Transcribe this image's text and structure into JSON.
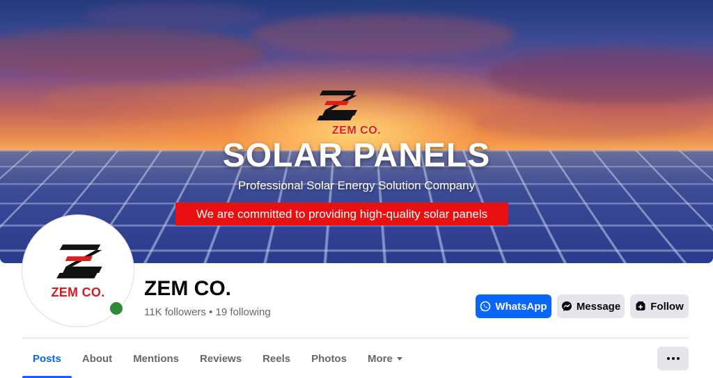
{
  "cover": {
    "brand_name": "ZEM CO.",
    "headline": "SOLAR PANELS",
    "subline": "Professional Solar Energy Solution Company",
    "banner": "We are committed to providing high-quality solar panels"
  },
  "profile": {
    "avatar_brand": "ZEM CO.",
    "name": "ZEM CO.",
    "stats": "11K followers • 19 following",
    "online": true
  },
  "actions": {
    "whatsapp": {
      "label": "WhatsApp",
      "icon": "whatsapp-icon"
    },
    "message": {
      "label": "Message",
      "icon": "messenger-icon"
    },
    "follow": {
      "label": "Follow",
      "icon": "follow-icon"
    }
  },
  "tabs": [
    {
      "label": "Posts",
      "active": true
    },
    {
      "label": "About"
    },
    {
      "label": "Mentions"
    },
    {
      "label": "Reviews"
    },
    {
      "label": "Reels"
    },
    {
      "label": "Photos"
    },
    {
      "label": "More",
      "icon": "caret-down-icon"
    }
  ],
  "more_button_icon": "ellipsis-icon",
  "colors": {
    "accent": "#0866ff",
    "brand_red": "#e01e1e",
    "online": "#2d8a36",
    "button_gray": "#e4e6eb"
  }
}
